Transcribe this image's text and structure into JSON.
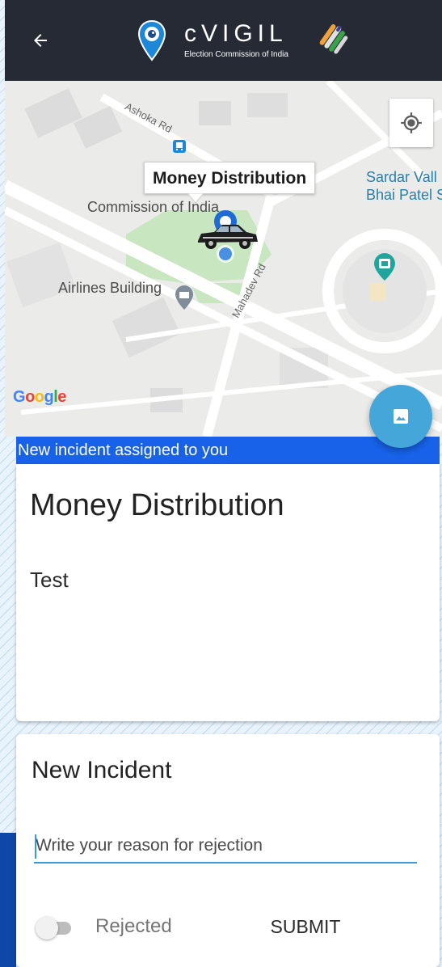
{
  "header": {
    "app_name": "cVIGIL",
    "subtitle": "Election Commission of India",
    "back_icon": "arrow-left-icon",
    "background": "#252a34"
  },
  "map": {
    "callout": "Money Distribution",
    "labels": {
      "commission": "Commission of India",
      "airlines": "Airlines Building",
      "sardar_line1": "Sardar Vall",
      "sardar_line2": "Bhai Patel S",
      "ashoka_rd": "Ashoka Rd",
      "mahadev_rd": "Mahadev Rd"
    },
    "google": {
      "g": "G",
      "o1": "o",
      "o2": "o",
      "g2": "g",
      "l": "l",
      "e": "e"
    },
    "locate_icon": "my-location-icon",
    "marker_icon": "car-icon"
  },
  "fab": {
    "icon": "image-icon",
    "color": "#45a6d9"
  },
  "incident": {
    "banner": "New incident assigned to you",
    "banner_color": "#1762e8",
    "title": "Money Distribution",
    "description": "Test"
  },
  "rejection": {
    "title": "New Incident",
    "input_placeholder": "Write your reason for rejection",
    "input_value": "",
    "toggle_label": "Rejected",
    "toggle_on": false,
    "submit_label": "SUBMIT",
    "accent": "#3a9ad9"
  }
}
